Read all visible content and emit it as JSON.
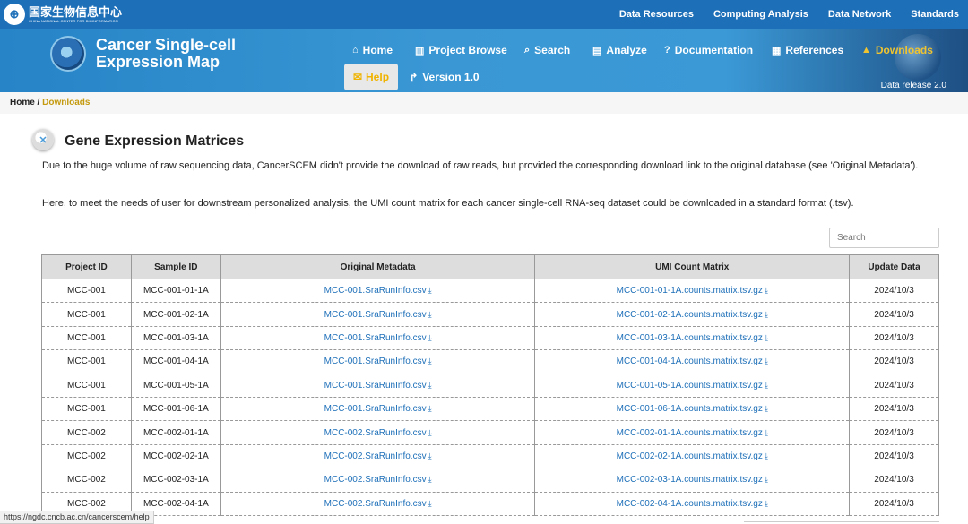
{
  "topbar": {
    "logo_cn": "国家生物信息中心",
    "logo_en": "CHINA NATIONAL CENTER FOR BIOINFORMATION",
    "links": [
      "Data Resources",
      "Computing Analysis",
      "Data Network",
      "Standards"
    ]
  },
  "brand": {
    "line1": "Cancer Single-cell",
    "line2": "Expression Map"
  },
  "nav": {
    "home": "Home",
    "project_browse": "Project Browse",
    "search": "Search",
    "analyze": "Analyze",
    "documentation": "Documentation",
    "references": "References",
    "downloads": "Downloads",
    "help": "Help",
    "version": "Version 1.0",
    "release": "Data release 2.0"
  },
  "breadcrumb": {
    "home": "Home /",
    "current": "Downloads"
  },
  "section": {
    "title": "Gene Expression Matrices",
    "para1": "Due to the huge volume of raw sequencing data, CancerSCEM didn't provide the download of raw reads, but provided the corresponding download link to the original database (see 'Original Metadata').",
    "para2": "Here, to meet the needs of user for downstream personalized analysis, the UMI count matrix for each cancer single-cell RNA-seq dataset could be downloaded in a standard format (.tsv)."
  },
  "search": {
    "placeholder": "Search"
  },
  "table": {
    "headers": [
      "Project ID",
      "Sample ID",
      "Original Metadata",
      "UMI Count Matrix",
      "Update Data"
    ],
    "rows": [
      [
        "MCC-001",
        "MCC-001-01-1A",
        "MCC-001.SraRunInfo.csv",
        "MCC-001-01-1A.counts.matrix.tsv.gz",
        "2024/10/3"
      ],
      [
        "MCC-001",
        "MCC-001-02-1A",
        "MCC-001.SraRunInfo.csv",
        "MCC-001-02-1A.counts.matrix.tsv.gz",
        "2024/10/3"
      ],
      [
        "MCC-001",
        "MCC-001-03-1A",
        "MCC-001.SraRunInfo.csv",
        "MCC-001-03-1A.counts.matrix.tsv.gz",
        "2024/10/3"
      ],
      [
        "MCC-001",
        "MCC-001-04-1A",
        "MCC-001.SraRunInfo.csv",
        "MCC-001-04-1A.counts.matrix.tsv.gz",
        "2024/10/3"
      ],
      [
        "MCC-001",
        "MCC-001-05-1A",
        "MCC-001.SraRunInfo.csv",
        "MCC-001-05-1A.counts.matrix.tsv.gz",
        "2024/10/3"
      ],
      [
        "MCC-001",
        "MCC-001-06-1A",
        "MCC-001.SraRunInfo.csv",
        "MCC-001-06-1A.counts.matrix.tsv.gz",
        "2024/10/3"
      ],
      [
        "MCC-002",
        "MCC-002-01-1A",
        "MCC-002.SraRunInfo.csv",
        "MCC-002-01-1A.counts.matrix.tsv.gz",
        "2024/10/3"
      ],
      [
        "MCC-002",
        "MCC-002-02-1A",
        "MCC-002.SraRunInfo.csv",
        "MCC-002-02-1A.counts.matrix.tsv.gz",
        "2024/10/3"
      ],
      [
        "MCC-002",
        "MCC-002-03-1A",
        "MCC-002.SraRunInfo.csv",
        "MCC-002-03-1A.counts.matrix.tsv.gz",
        "2024/10/3"
      ],
      [
        "MCC-002",
        "MCC-002-04-1A",
        "MCC-002.SraRunInfo.csv",
        "MCC-002-04-1A.counts.matrix.tsv.gz",
        "2024/10/3"
      ]
    ]
  },
  "statusbar": {
    "url": "https://ngdc.cncb.ac.cn/cancerscem/help"
  },
  "colors": {
    "primary": "#1d6fb8",
    "accent": "#f0c430",
    "link": "#1d6fb8"
  }
}
